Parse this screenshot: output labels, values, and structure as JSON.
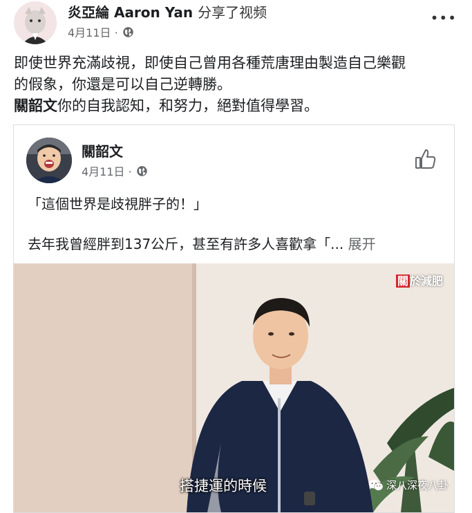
{
  "post": {
    "author": "炎亞綸 Aaron Yan",
    "action": "分享了视频",
    "date": "4月11日 ·",
    "more_label": "•••",
    "text_line1": "即使世界充滿歧視，即使自己曾用各種荒唐理由製造自己樂觀",
    "text_line2": "的假象，你還是可以自己逆轉勝。",
    "tag_name": "關韶文",
    "text_line3": "你的自我認知，和努力，絕對值得學習。"
  },
  "shared": {
    "author": "關韶文",
    "date": "4月11日 ·",
    "quote": "「這個世界是歧視胖子的！」",
    "excerpt": "去年我曾經胖到137公斤，甚至有許多人喜歡拿「...",
    "expand_label": "展开"
  },
  "video": {
    "watermark_red": "關",
    "watermark_rest": "於減肥",
    "subtitle": "搭捷運的時候",
    "channel_watermark": "深八深夜八卦"
  },
  "icons": {
    "privacy": "globe-icon",
    "like": "thumbs-up-icon",
    "wechat": "wechat-icon"
  },
  "colors": {
    "secondary_text": "#65676b",
    "watermark_red": "#d7262b"
  }
}
